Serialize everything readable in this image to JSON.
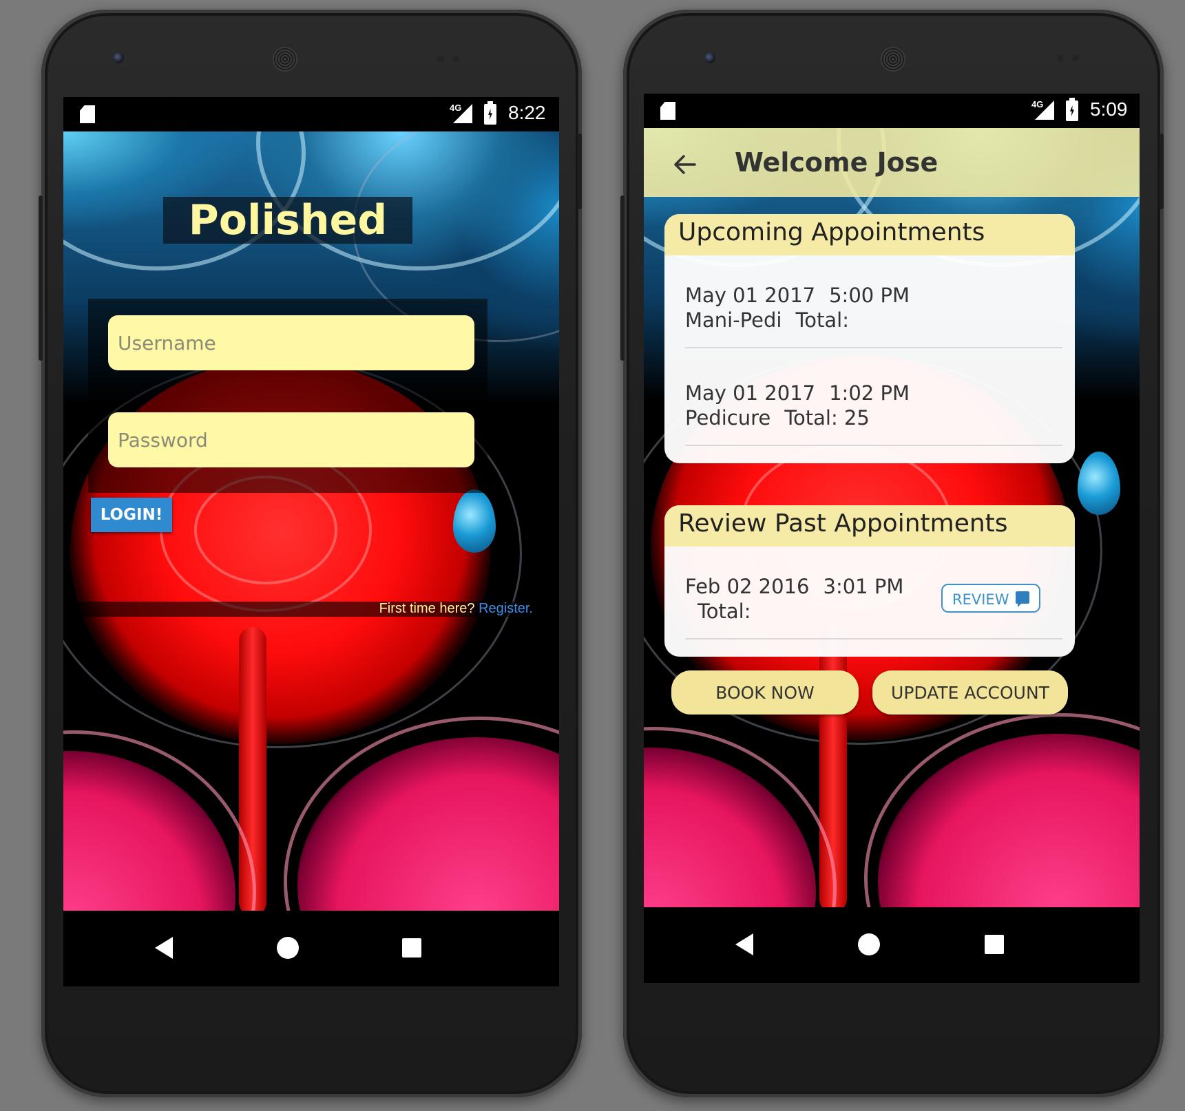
{
  "left_phone": {
    "status": {
      "network": "4G",
      "time": "8:22"
    },
    "brand": "Polished",
    "username_placeholder": "Username",
    "password_placeholder": "Password",
    "login_label": "LOGIN!",
    "register_prompt": "First time here?",
    "register_link": "Register."
  },
  "right_phone": {
    "status": {
      "network": "4G",
      "time": "5:09"
    },
    "toolbar_title": "Welcome Jose",
    "upcoming": {
      "title": "Upcoming Appointments",
      "items": [
        {
          "date": "May 01 2017",
          "time": "5:00 PM",
          "service": "Mani-Pedi",
          "total": "Total:"
        },
        {
          "date": "May 01 2017",
          "time": "1:02 PM",
          "service": "Pedicure",
          "total": "Total: 25"
        }
      ]
    },
    "past": {
      "title": "Review Past Appointments",
      "items": [
        {
          "date": "Feb 02 2016",
          "time": "3:01 PM",
          "total": "Total:",
          "review_label": "REVIEW"
        }
      ]
    },
    "book_label": "BOOK NOW",
    "update_label": "UPDATE ACCOUNT"
  },
  "icons": {
    "sd": "sd-card-icon",
    "signal": "signal-icon",
    "battery": "battery-charging-icon",
    "back": "arrow-back-icon",
    "chat": "chat-bubble-icon",
    "nav_back": "nav-back-icon",
    "nav_home": "nav-home-icon",
    "nav_recent": "nav-recent-icon"
  },
  "colors": {
    "accent_yellow": "#fff8a6",
    "login_blue": "#2f8ad0",
    "link_blue": "#3a8ee8",
    "header_yellow": "#f5eba0"
  }
}
